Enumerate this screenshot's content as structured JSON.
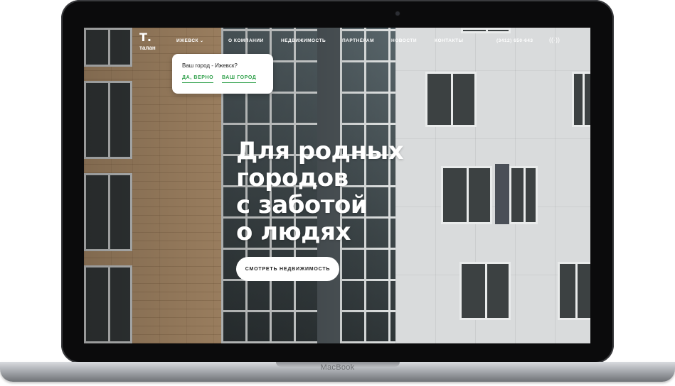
{
  "site": {
    "logo_mark": "Т.",
    "logo_text": "талан"
  },
  "nav": {
    "city": "ИЖЕВСК",
    "items": [
      "О КОМПАНИИ",
      "НЕДВИЖИМОСТЬ",
      "ПАРТНЁРАМ",
      "НОВОСТИ",
      "КОНТАКТЫ"
    ],
    "phone": "(3412) 650-643",
    "sound_icon": "sound-waves-icon"
  },
  "city_popup": {
    "question": "Ваш город - Ижевск?",
    "confirm_label": "ДА, ВЕРНО",
    "choose_label": "ВАШ ГОРОД"
  },
  "hero": {
    "title_lines": [
      "Для родных",
      "городов",
      "с заботой",
      "о людях"
    ],
    "cta_label": "СМОТРЕТЬ НЕДВИЖИМОСТЬ"
  },
  "device": {
    "brand": "MacBook"
  },
  "colors": {
    "accent_green": "#2fa04a",
    "text_white": "#ffffff"
  }
}
